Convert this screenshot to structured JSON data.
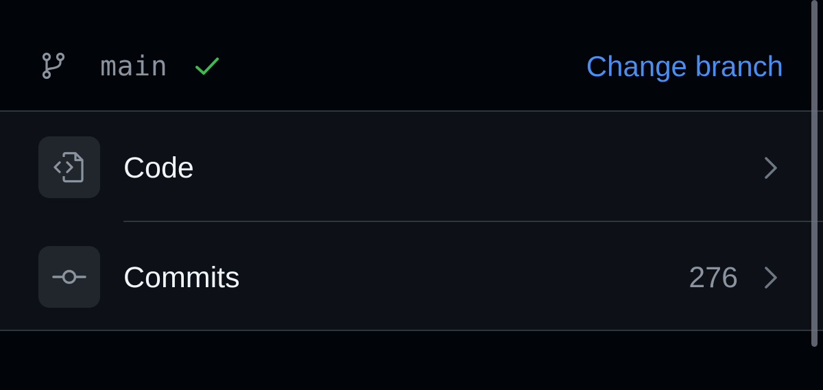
{
  "branch": {
    "name": "main",
    "icon": "git-branch-icon",
    "status_icon": "check-icon",
    "status_color": "#3fb950",
    "change_label": "Change branch",
    "change_color": "#4a8ef2"
  },
  "list": {
    "items": [
      {
        "label": "Code",
        "icon": "file-code-icon",
        "count": ""
      },
      {
        "label": "Commits",
        "icon": "git-commit-icon",
        "count": "276"
      }
    ]
  }
}
